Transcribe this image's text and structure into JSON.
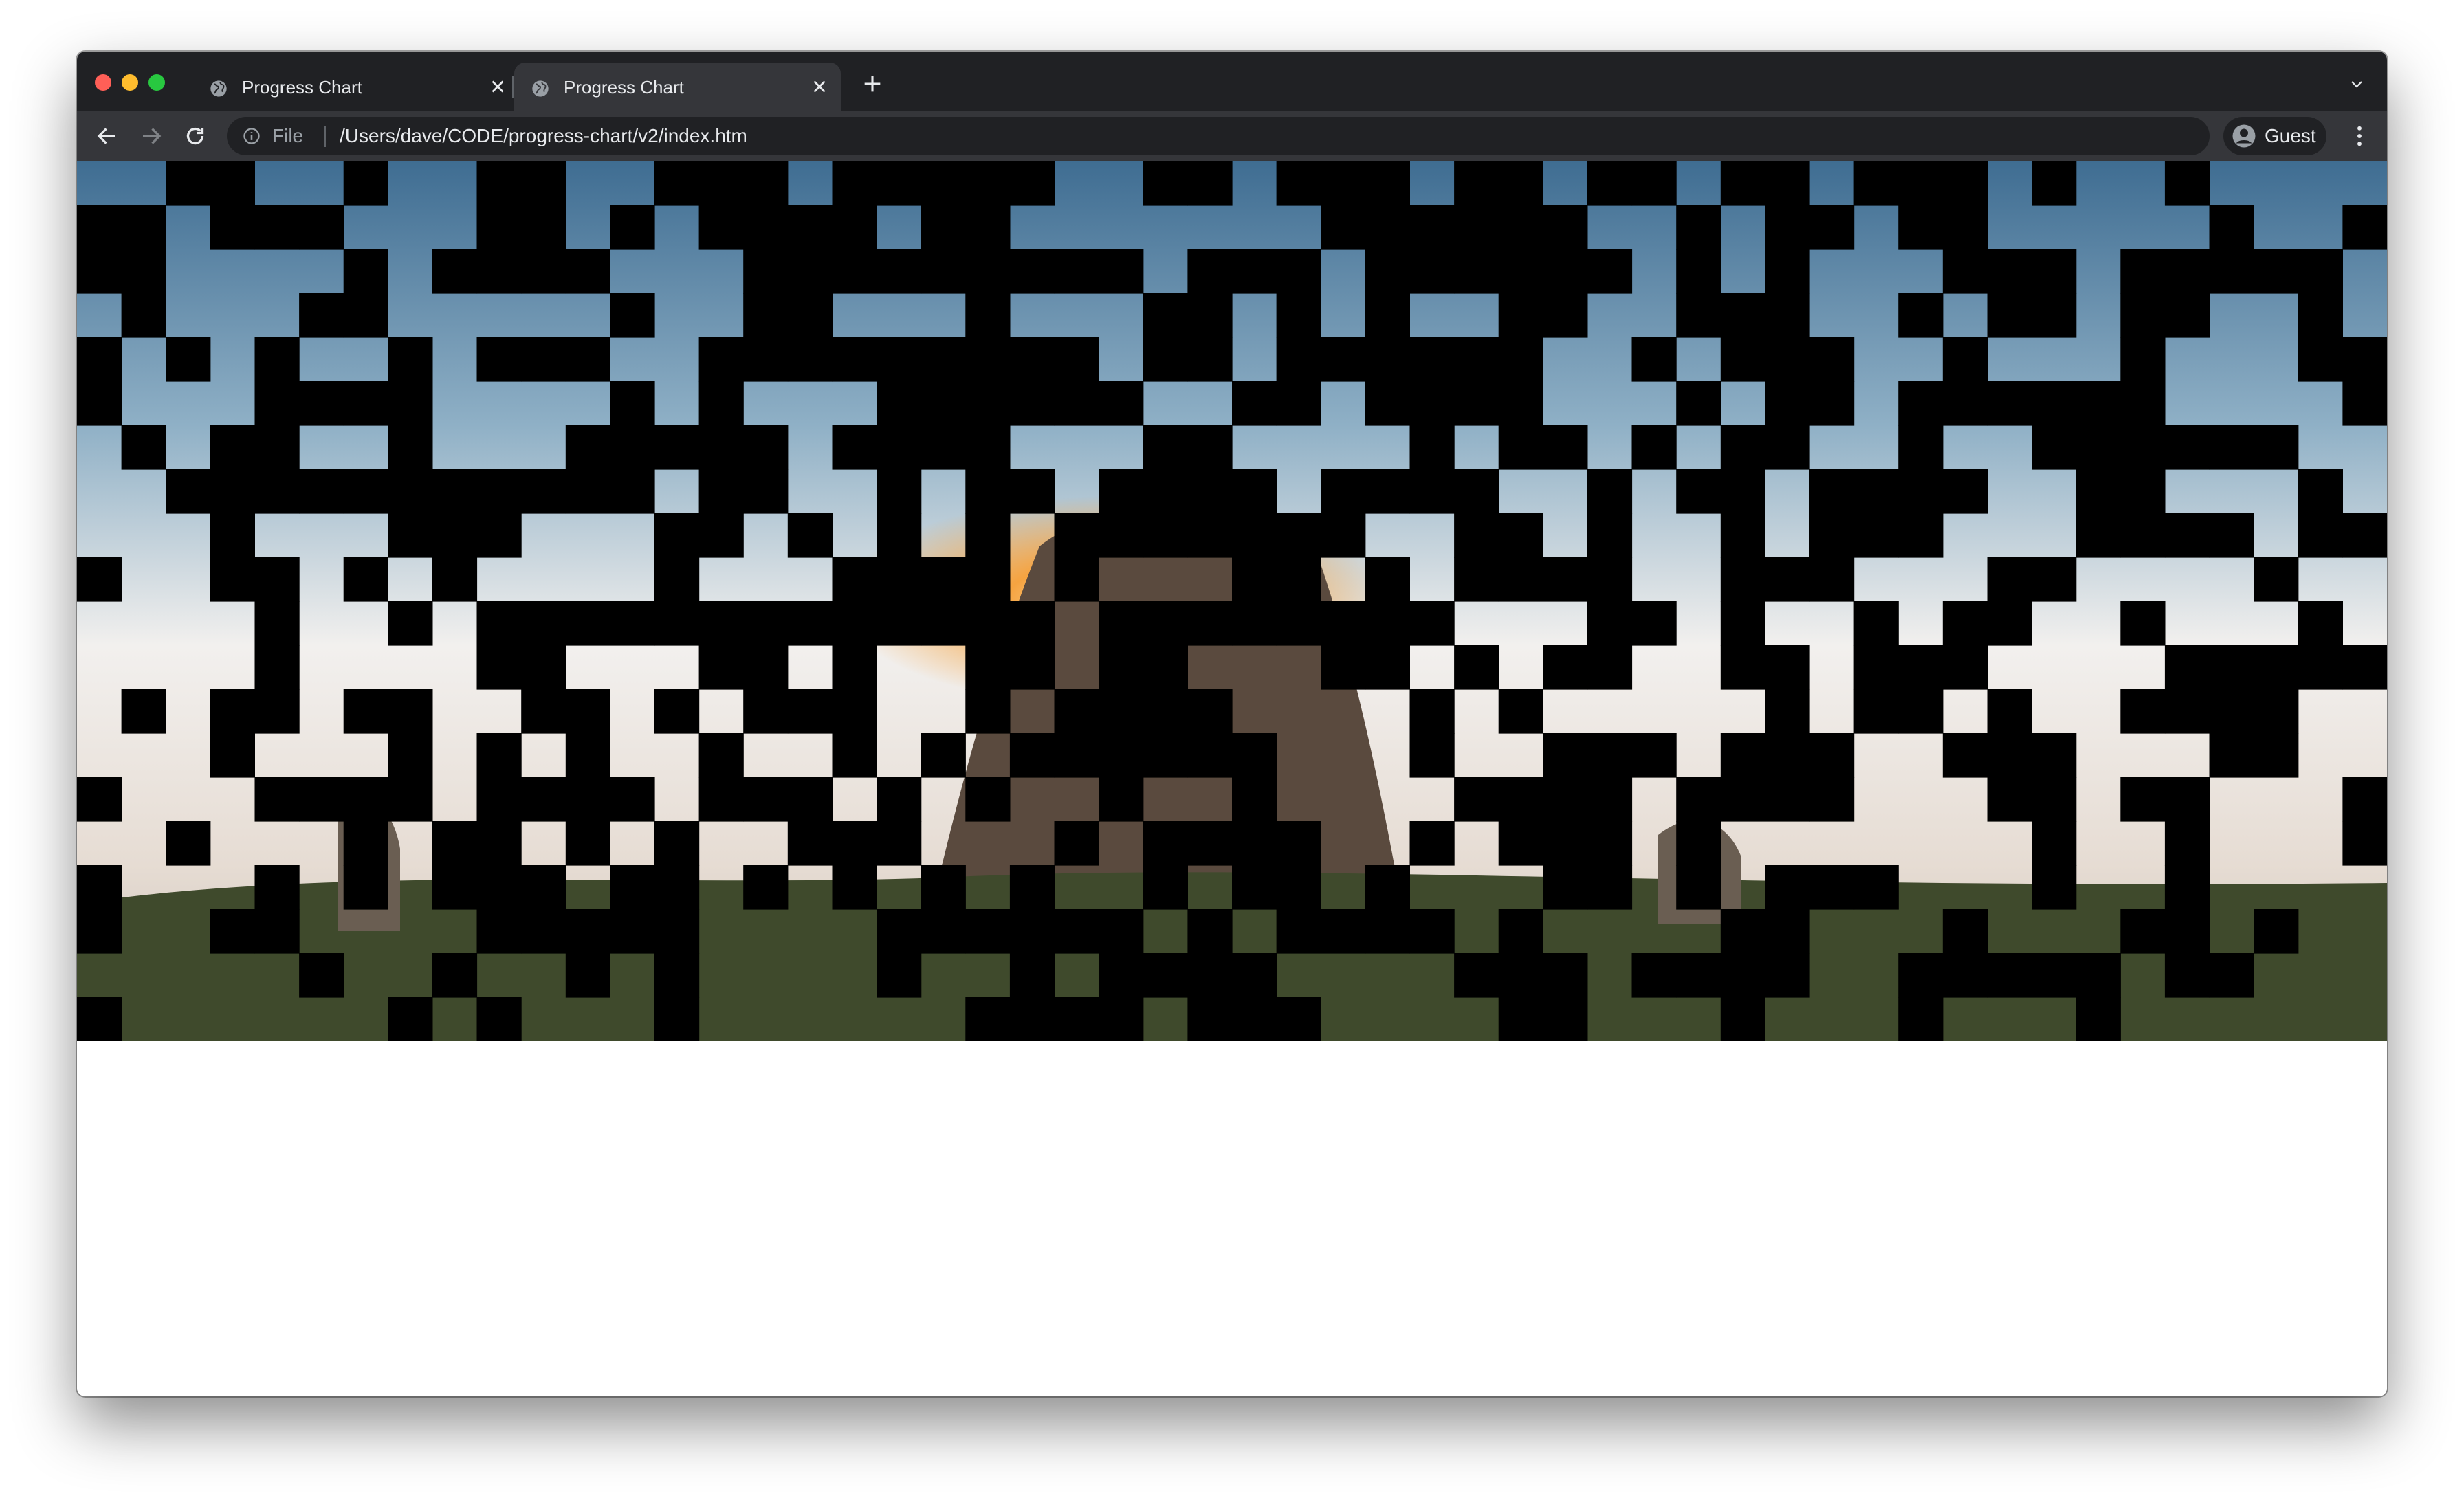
{
  "tabs": [
    {
      "title": "Progress Chart",
      "active": false
    },
    {
      "title": "Progress Chart",
      "active": true
    }
  ],
  "toolbar": {
    "scheme_label": "File",
    "url": "/Users/dave/CODE/progress-chart/v2/index.htm",
    "profile_name": "Guest"
  },
  "icons": {
    "tab_favicon": "globe-icon",
    "tab_close": "close-icon",
    "new_tab": "plus-icon",
    "tab_search": "chevron-down-icon",
    "back": "arrow-left-icon",
    "forward": "arrow-right-icon",
    "reload": "reload-icon",
    "site_info": "info-icon",
    "profile": "avatar-icon",
    "menu": "kebab-menu-icon"
  },
  "colors": {
    "titlebar": "#202124",
    "toolbar": "#35363a",
    "active_tab": "#35363a",
    "text": "#e8eaed",
    "muted_text": "#9aa0a6"
  },
  "page": {
    "image_subject": "landscape photo of rock formations at sunset with a blue sky, partially covered by a grid of black tiles",
    "tile_grid": {
      "columns": 52,
      "rows": 20
    }
  }
}
